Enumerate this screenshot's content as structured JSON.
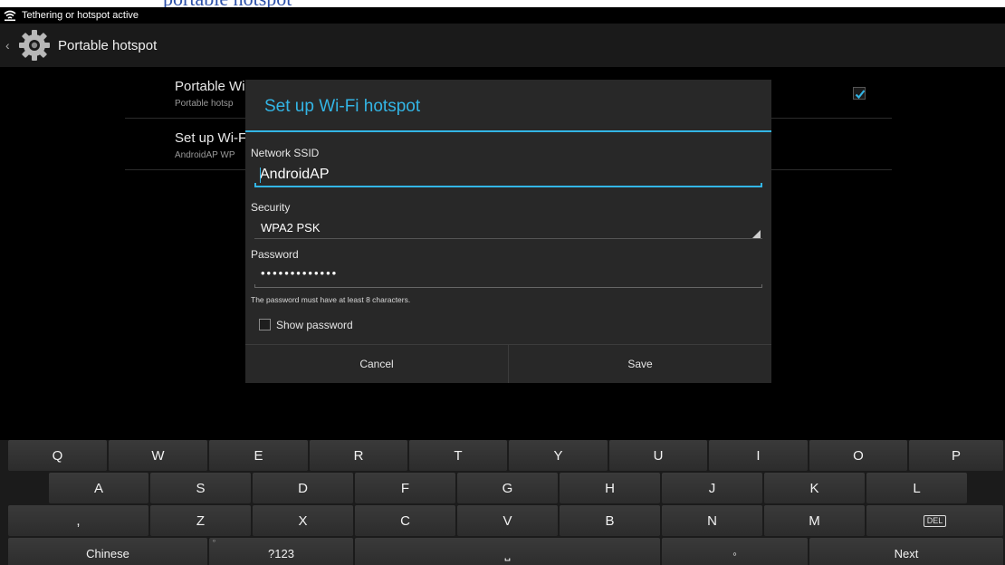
{
  "top_strip": {
    "text": "portable hotspot"
  },
  "status_bar": {
    "icon": "wifi-icon",
    "text": "Tethering or hotspot active"
  },
  "action_bar": {
    "back_icon": "back-caret-icon",
    "app_icon": "gear-icon",
    "title": "Portable hotspot"
  },
  "settings": [
    {
      "title": "Portable Wi",
      "subtitle": "Portable hotsp",
      "checked": true
    },
    {
      "title": "Set up Wi-F",
      "subtitle": "AndroidAP WP"
    }
  ],
  "colors": {
    "accent": "#33b5e5",
    "dialog_bg": "#282828",
    "background": "#000000"
  },
  "dialog": {
    "title": "Set up Wi-Fi hotspot",
    "ssid_label": "Network SSID",
    "ssid_value": "AndroidAP",
    "security_label": "Security",
    "security_value": "WPA2 PSK",
    "password_label": "Password",
    "password_value": "•••••••••••••",
    "password_hint": "The password must have at least 8 characters.",
    "show_password_label": "Show password",
    "show_password_checked": false,
    "cancel_label": "Cancel",
    "save_label": "Save"
  },
  "keyboard": {
    "row1": [
      "Q",
      "W",
      "E",
      "R",
      "T",
      "Y",
      "U",
      "I",
      "O",
      "P"
    ],
    "row2": [
      "A",
      "S",
      "D",
      "F",
      "G",
      "H",
      "J",
      "K",
      "L"
    ],
    "row3": [
      ",",
      "Z",
      "X",
      "C",
      "V",
      "B",
      "N",
      "M"
    ],
    "delete_label": "DEL",
    "language_label": "Chinese",
    "symbols_label": "?123",
    "symbols_corner": "⁰",
    "space_label": "⎵",
    "period_label": "◦",
    "next_label": "Next"
  }
}
